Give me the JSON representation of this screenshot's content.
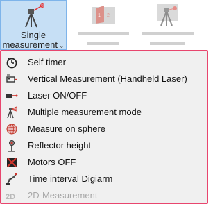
{
  "toolbar": {
    "single_measurement": {
      "line1": "Single",
      "line2": "measurement",
      "chevron": "⌄",
      "icon": "laser-tripod-icon"
    },
    "dim_buttons": [
      {
        "icon": "red-panel-12-icon"
      },
      {
        "icon": "tripod-red-target-icon"
      }
    ]
  },
  "menu": {
    "items": [
      {
        "label": "Self timer",
        "icon": "self-timer-icon",
        "enabled": true
      },
      {
        "label": "Vertical Measurement (Handheld Laser)",
        "icon": "vertical-measurement-icon",
        "enabled": true
      },
      {
        "label": "Laser ON/OFF",
        "icon": "laser-icon",
        "enabled": true
      },
      {
        "label": "Multiple measurement mode",
        "icon": "multiple-measurement-icon",
        "enabled": true
      },
      {
        "label": "Measure on sphere",
        "icon": "sphere-icon",
        "enabled": true
      },
      {
        "label": "Reflector height",
        "icon": "reflector-height-icon",
        "enabled": true
      },
      {
        "label": "Motors OFF",
        "icon": "motors-off-icon",
        "enabled": true
      },
      {
        "label": "Time interval Digiarm",
        "icon": "digiarm-icon",
        "enabled": true
      },
      {
        "label": "2D-Measurement",
        "icon": "2d-icon",
        "enabled": false
      }
    ]
  },
  "colors": {
    "active_bg": "#c6dff5",
    "active_border": "#7eb4ea",
    "menu_border": "#e8466e",
    "menu_bg": "#f0f0f0",
    "disabled_text": "#a8a8a8"
  }
}
